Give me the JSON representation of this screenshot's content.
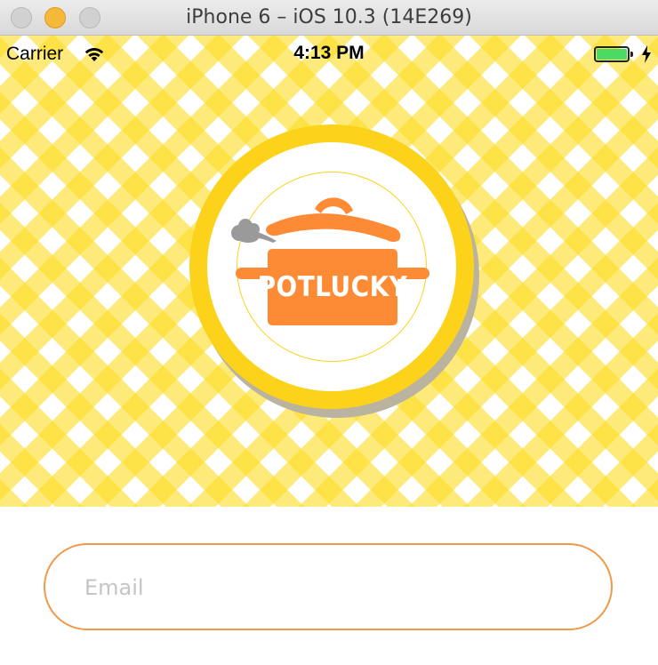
{
  "window": {
    "title": "iPhone 6 – iOS 10.3 (14E269)",
    "controls": [
      "close",
      "minimize",
      "zoom"
    ]
  },
  "status_bar": {
    "carrier": "Carrier",
    "time": "4:13 PM",
    "icons": [
      "wifi-icon",
      "battery-icon",
      "charging-bolt-icon"
    ],
    "battery_level": 1.0
  },
  "logo": {
    "text": "POTLUCKY",
    "icon": "cooking-pot-icon"
  },
  "login_form": {
    "email_placeholder": "Email",
    "email_value": ""
  },
  "colors": {
    "accent_orange": "#ee9a4a",
    "pot_orange": "#fd8b36",
    "gingham_yellow": "#fdde28",
    "logo_ring_yellow": "#fdd21a",
    "battery_green": "#4cd964"
  }
}
